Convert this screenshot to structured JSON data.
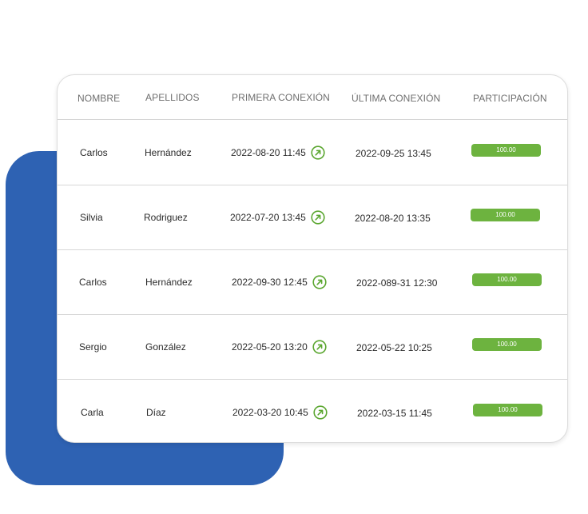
{
  "table": {
    "headers": {
      "nombre": "NOMBRE",
      "apellidos": "APELLIDOS",
      "primera": "PRIMERA CONEXIÓN",
      "ultima": "ÚLTIMA CONEXIÓN",
      "participacion": "PARTICIPACIÓN"
    },
    "rows": [
      {
        "nombre": "Carlos",
        "apellidos": "Hernández",
        "primera": "2022-08-20 11:45",
        "ultima": "2022-09-25 13:45",
        "participacion": "100.00"
      },
      {
        "nombre": "Silvia",
        "apellidos": "Rodriguez",
        "primera": "2022-07-20 13:45",
        "ultima": "2022-08-20 13:35",
        "participacion": "100.00"
      },
      {
        "nombre": "Carlos",
        "apellidos": "Hernández",
        "primera": "2022-09-30 12:45",
        "ultima": "2022-089-31 12:30",
        "participacion": "100.00"
      },
      {
        "nombre": "Sergio",
        "apellidos": "González",
        "primera": "2022-05-20 13:20",
        "ultima": "2022-05-22 10:25",
        "participacion": "100.00"
      },
      {
        "nombre": "Carla",
        "apellidos": "Díaz",
        "primera": "2022-03-20 10:45",
        "ultima": "2022-03-15 11:45",
        "participacion": "100.00"
      }
    ]
  },
  "icons": {
    "open_link": "arrow-up-right-circle-icon"
  },
  "colors": {
    "backdrop": "#2e62b3",
    "badge": "#6db33f",
    "icon": "#5aa62f"
  }
}
